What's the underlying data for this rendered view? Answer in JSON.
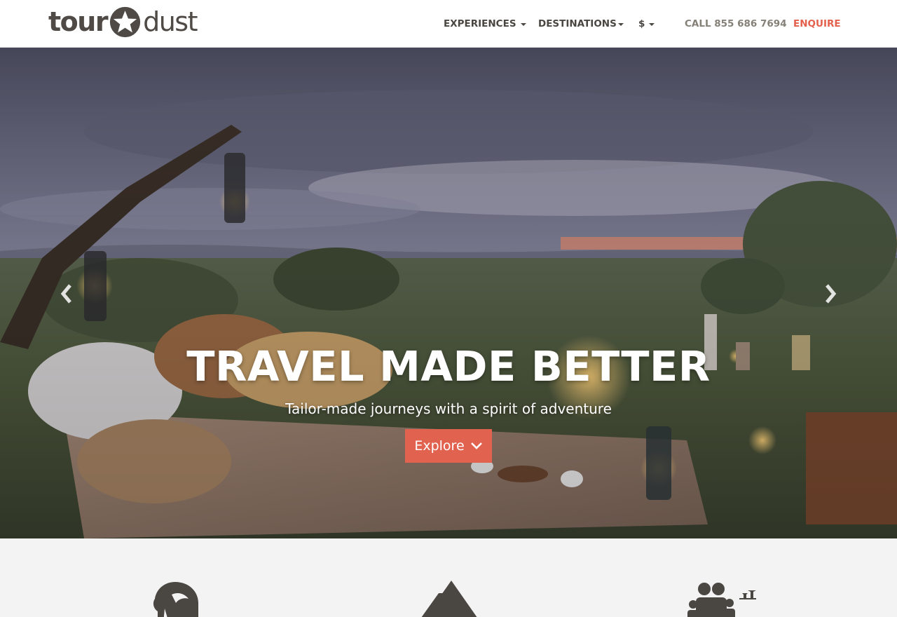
{
  "brand": {
    "logo_left": "tour",
    "logo_right": "dust",
    "logo_icon": "star-icon",
    "accent_color": "#e26250",
    "text_color": "#4a4642"
  },
  "nav": {
    "experiences": "EXPERIENCES",
    "destinations": "DESTINATIONS",
    "currency": "$",
    "call": "CALL 855 686 7694",
    "enquire": "ENQUIRE"
  },
  "hero": {
    "title": "TRAVEL MADE BETTER",
    "subtitle": "Tailor-made journeys with a spirit of adventure",
    "cta_label": "Explore",
    "cta_icon": "chevron-down-icon",
    "prev_icon": "chevron-left-icon",
    "next_icon": "chevron-right-icon"
  },
  "features": [
    {
      "icon": "elephant-icon"
    },
    {
      "icon": "mountain-icon"
    },
    {
      "icon": "family-icon"
    }
  ]
}
